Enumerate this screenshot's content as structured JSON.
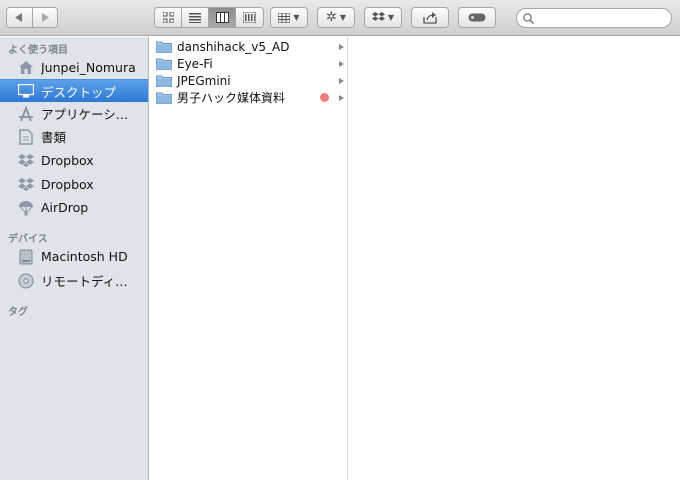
{
  "toolbar": {
    "search": {
      "placeholder": "",
      "value": ""
    }
  },
  "sidebar": {
    "favorites_title": "よく使う項目",
    "favorites": [
      {
        "label": "Junpei_Nomura",
        "icon": "home-icon"
      },
      {
        "label": "デスクトップ",
        "icon": "desktop-icon",
        "selected": true
      },
      {
        "label": "アプリケーシ…",
        "icon": "applications-icon"
      },
      {
        "label": "書類",
        "icon": "documents-icon"
      },
      {
        "label": "Dropbox",
        "icon": "dropbox-icon"
      },
      {
        "label": "Dropbox",
        "icon": "dropbox-icon"
      },
      {
        "label": "AirDrop",
        "icon": "airdrop-icon"
      }
    ],
    "devices_title": "デバイス",
    "devices": [
      {
        "label": "Macintosh HD",
        "icon": "hard-drive-icon"
      },
      {
        "label": "リモートディ…",
        "icon": "remote-disc-icon"
      }
    ],
    "tags_title": "タグ"
  },
  "files": [
    {
      "name": "danshihack_v5_AD",
      "tag_color": ""
    },
    {
      "name": "Eye-Fi",
      "tag_color": ""
    },
    {
      "name": "JPEGmini",
      "tag_color": ""
    },
    {
      "name": "男子ハック媒体資料",
      "tag_color": "#f07c7c"
    }
  ],
  "colors": {
    "sidebar_bg": "#dfe4ea",
    "selection": "#2f78d6",
    "folder": "#8fb8e0"
  }
}
